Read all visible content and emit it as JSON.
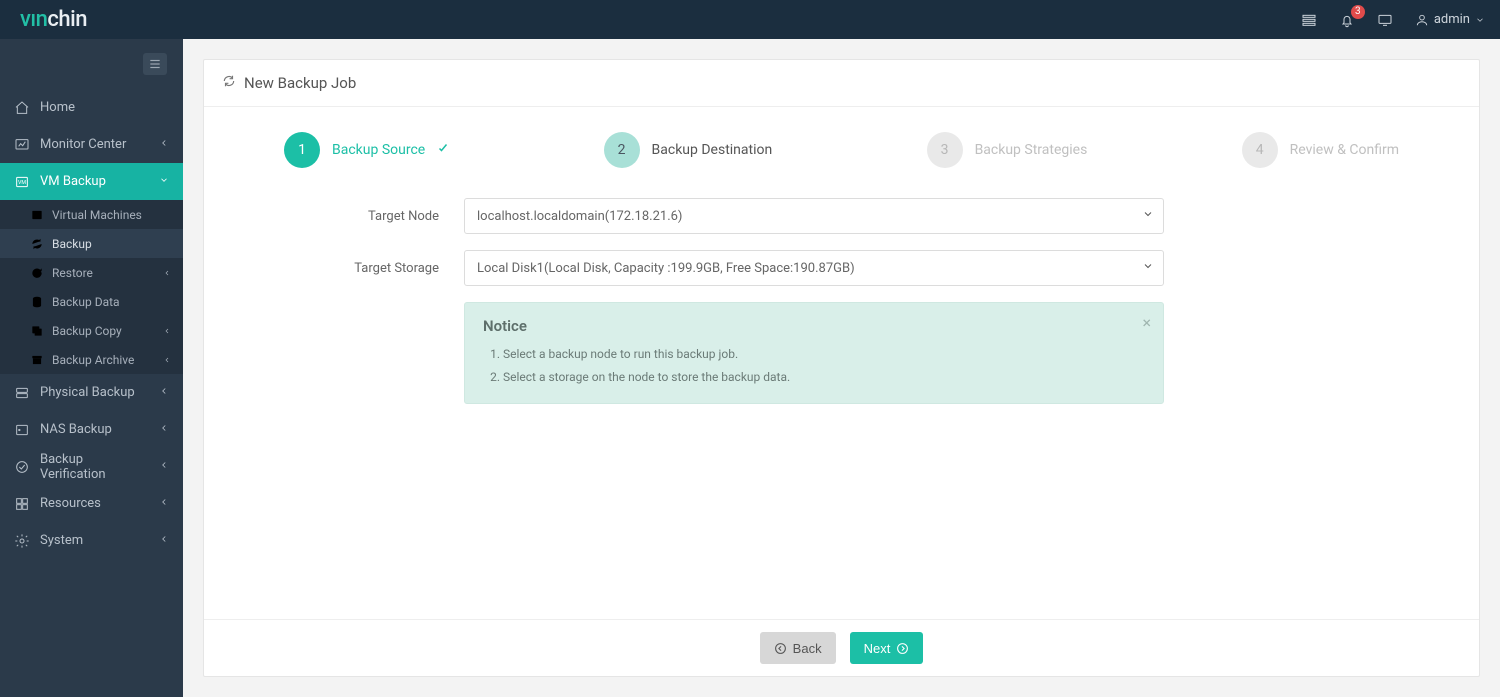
{
  "brand": {
    "part1": "vın",
    "part2": "chin"
  },
  "header": {
    "badge": "3",
    "user": "admin"
  },
  "sidebar": {
    "home": "Home",
    "monitor": "Monitor Center",
    "vmbackup": "VM Backup",
    "vmbackup_sub": {
      "virtual_machines": "Virtual Machines",
      "backup": "Backup",
      "restore": "Restore",
      "backup_data": "Backup Data",
      "backup_copy": "Backup Copy",
      "backup_archive": "Backup Archive"
    },
    "physical": "Physical Backup",
    "nas": "NAS Backup",
    "verification": "Backup Verification",
    "resources": "Resources",
    "system": "System"
  },
  "page": {
    "title": "New Backup Job",
    "steps": {
      "s1": "Backup Source",
      "s2": "Backup Destination",
      "s3": "Backup Strategies",
      "s4": "Review & Confirm"
    },
    "form": {
      "target_node_label": "Target Node",
      "target_node_value": "localhost.localdomain(172.18.21.6)",
      "target_storage_label": "Target Storage",
      "target_storage_value": "Local Disk1(Local Disk, Capacity :199.9GB, Free Space:190.87GB)"
    },
    "notice": {
      "title": "Notice",
      "items": [
        "Select a backup node to run this backup job.",
        "Select a storage on the node to store the backup data."
      ]
    },
    "buttons": {
      "back": "Back",
      "next": "Next"
    }
  }
}
